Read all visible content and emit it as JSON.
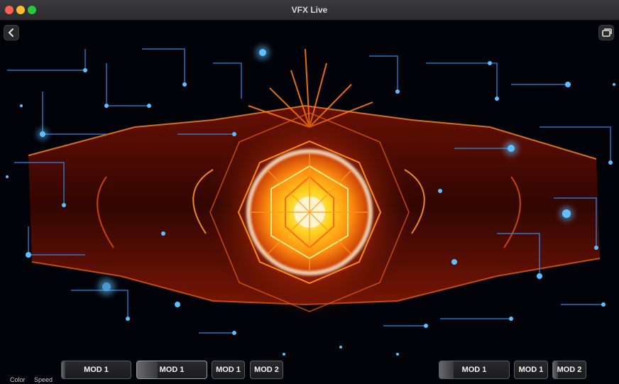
{
  "window": {
    "title": "VFX Live"
  },
  "toolbar": {
    "back_icon": "chevron-left-icon",
    "window_icon": "window-stack-icon"
  },
  "controls": {
    "left_labels": [
      "Color",
      "Speed"
    ],
    "mod_buttons_left": [
      {
        "label": "MOD 1",
        "level": 0.05
      },
      {
        "label": "MOD 1",
        "level": 0.3
      },
      {
        "label": "MOD 1",
        "level": 0
      },
      {
        "label": "MOD 2",
        "level": 0
      }
    ],
    "mod_buttons_right": [
      {
        "label": "MOD 1",
        "level": 0.2
      },
      {
        "label": "MOD 1",
        "level": 0
      },
      {
        "label": "MOD 2",
        "level": 0.15
      }
    ]
  },
  "colors": {
    "accent_orange": "#ff7a10",
    "core_yellow": "#ffe03a",
    "particle_blue": "#3aa8ff"
  }
}
